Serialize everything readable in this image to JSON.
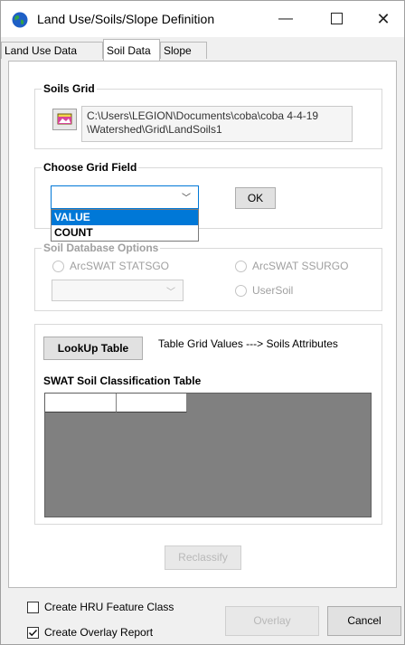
{
  "window": {
    "title": "Land Use/Soils/Slope Definition",
    "controls": {
      "minimize": "—",
      "close": "✕"
    }
  },
  "tabs": [
    {
      "label": "Land Use Data",
      "active": false
    },
    {
      "label": "Soil Data",
      "active": true
    },
    {
      "label": "Slope",
      "active": false
    }
  ],
  "soils_grid": {
    "title": "Soils Grid",
    "path_line1": "C:\\Users\\LEGION\\Documents\\coba\\coba 4-4-19",
    "path_line2": "\\Watershed\\Grid\\LandSoils1"
  },
  "choose_grid_field": {
    "title": "Choose Grid Field",
    "selected": "",
    "ok_label": "OK",
    "options": [
      "VALUE",
      "COUNT"
    ]
  },
  "soil_database_options": {
    "title": "Soil Database Options",
    "options": [
      "ArcSWAT STATSGO",
      "ArcSWAT SSURGO",
      "UserSoil"
    ]
  },
  "lookup": {
    "button_label": "LookUp Table",
    "description": "Table Grid Values ---> Soils Attributes",
    "table_title": "SWAT Soil Classification Table"
  },
  "reclassify_label": "Reclassify",
  "footer": {
    "create_hru_label": "Create HRU Feature Class",
    "create_hru_checked": false,
    "create_overlay_label": "Create Overlay Report",
    "create_overlay_checked": true,
    "overlay_label": "Overlay",
    "cancel_label": "Cancel"
  },
  "icons": {
    "app": "globe-icon",
    "folder": "folder-icon",
    "dropdown": "chevron-down-icon"
  },
  "colors": {
    "accent": "#0078d7",
    "table_bg": "#808080"
  }
}
